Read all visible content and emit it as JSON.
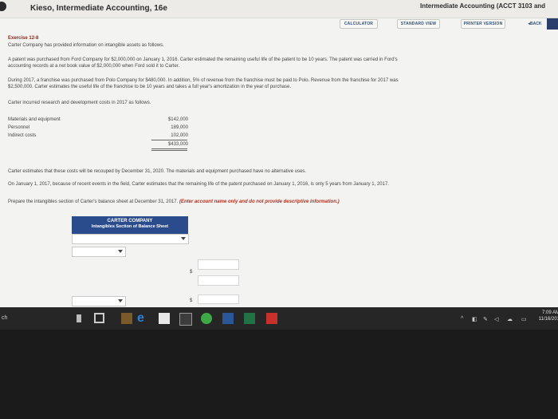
{
  "header": {
    "book_title": "Kieso, Intermediate Accounting, 16e",
    "course_title": "Intermediate Accounting (ACCT 3103 and"
  },
  "toolbar": {
    "calculator": "CALCULATOR",
    "standard_view": "STANDARD VIEW",
    "printer_version": "PRINTER VERSION",
    "back": "◂BACK"
  },
  "exercise": {
    "title": "Exercise 12-8",
    "intro": "Carter Company has provided information on intangible assets as follows.",
    "para1_l1": "A patent was purchased from Ford Company for $2,000,000 on January 1, 2016. Carter estimated the remaining useful life of the patent to be 10 years. The patent was carried in Ford's",
    "para1_l2": "accounting records at a net book value of $2,000,000 when Ford sold it to Carter.",
    "para2_l1": "During 2017, a franchise was purchased from Polo Company for $480,000. In addition, 5% of revenue from the franchise must be paid to Polo. Revenue from the franchise for 2017 was",
    "para2_l2": "$2,500,000. Carter estimates the useful life of the franchise to be 10 years and takes a full year's amortization in the year of purchase.",
    "rd_intro": "Carter incurred research and development costs in 2017 as follows.",
    "costs": [
      {
        "label": "Materials and equipment",
        "amount": "$142,000"
      },
      {
        "label": "Personnel",
        "amount": "189,000"
      },
      {
        "label": "Indirect costs",
        "amount": "102,000"
      }
    ],
    "total": "$433,000",
    "recoup": "Carter estimates that these costs will be recouped by December 31, 2020. The materials and equipment purchased have no alternative uses.",
    "patent_update": "On January 1, 2017, because of recent events in the field, Carter estimates that the remaining life of the patent purchased on January 1, 2016, is only 5 years from January 1, 2017.",
    "instruction": "Prepare the intangibles section of Carter's balance sheet at December 31, 2017.",
    "instruction_note": "(Enter account name only and do not provide descriptive information.)"
  },
  "form": {
    "company": "CARTER COMPANY",
    "section": "Intangibles Section of Balance Sheet",
    "dollar": "$"
  },
  "taskbar": {
    "time": "7:09 AM",
    "date": "11/16/201",
    "left_text": "ch"
  }
}
